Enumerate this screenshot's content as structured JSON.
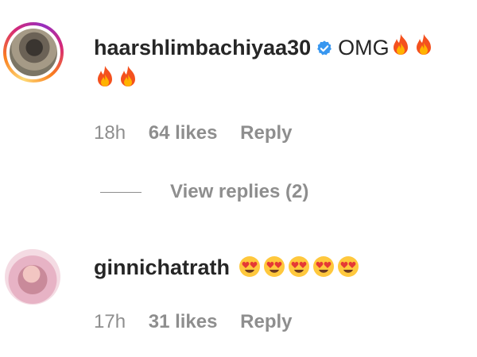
{
  "comments": [
    {
      "username": "haarshlimbachiyaa30",
      "verified": true,
      "text": "OMG",
      "time": "18h",
      "likes": "64 likes",
      "reply": "Reply",
      "view_replies": "View replies (2)",
      "emojis": [
        "fire-emoji",
        "fire-emoji",
        "fire-emoji",
        "fire-emoji"
      ]
    },
    {
      "username": "ginnichatrath",
      "verified": false,
      "text": "",
      "time": "17h",
      "likes": "31 likes",
      "reply": "Reply",
      "emojis": [
        "heart-eyes-emoji",
        "heart-eyes-emoji",
        "heart-eyes-emoji",
        "heart-eyes-emoji",
        "heart-eyes-emoji"
      ]
    }
  ],
  "colors": {
    "text": "#262626",
    "meta": "#8e8e8e",
    "verified": "#3897f0",
    "story_ring": "#d62976"
  }
}
